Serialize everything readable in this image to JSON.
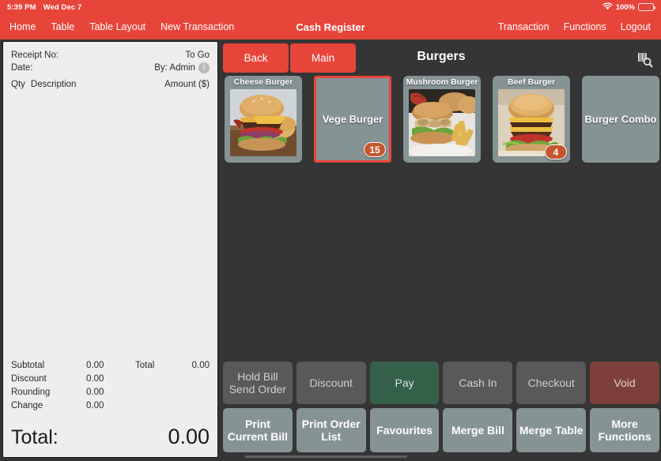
{
  "statusbar": {
    "time": "5:39 PM",
    "date": "Wed Dec 7",
    "wifi_icon": "wifi-icon",
    "battery_percent": "100%",
    "battery_icon": "battery-full-icon"
  },
  "navbar": {
    "title": "Cash Register",
    "left_items": [
      {
        "label": "Home",
        "name": "nav-home"
      },
      {
        "label": "Table",
        "name": "nav-table"
      },
      {
        "label": "Table Layout",
        "name": "nav-table-layout"
      },
      {
        "label": "New Transaction",
        "name": "nav-new-transaction"
      }
    ],
    "right_items": [
      {
        "label": "Transaction",
        "name": "nav-transaction"
      },
      {
        "label": "Functions",
        "name": "nav-functions"
      },
      {
        "label": "Logout",
        "name": "nav-logout"
      }
    ]
  },
  "receipt": {
    "receipt_no_label": "Receipt No:",
    "receipt_no_value": "",
    "order_type": "To Go",
    "date_label": "Date:",
    "date_value": "",
    "by_label": "By: Admin",
    "info_icon": "info-icon",
    "col_qty": "Qty",
    "col_description": "Description",
    "col_amount": "Amount ($)",
    "items": [],
    "totals": [
      {
        "label": "Subtotal",
        "value": "0.00"
      },
      {
        "label": "Discount",
        "value": "0.00"
      },
      {
        "label": "Rounding",
        "value": "0.00"
      },
      {
        "label": "Change",
        "value": "0.00"
      }
    ],
    "total_side_label": "Total",
    "total_side_value": "0.00",
    "grand_label": "Total:",
    "grand_value": "0.00"
  },
  "category_bar": {
    "back_label": "Back",
    "main_label": "Main",
    "title": "Burgers",
    "scan_icon": "barcode-search-icon"
  },
  "products": [
    {
      "name": "Cheese Burger",
      "badge": "",
      "has_image": true,
      "selected": false,
      "style": "photo"
    },
    {
      "name": "Vege Burger",
      "badge": "15",
      "has_image": false,
      "selected": true,
      "style": "plain"
    },
    {
      "name": "Mushroom Burger",
      "badge": "",
      "has_image": true,
      "selected": false,
      "style": "photo"
    },
    {
      "name": "Beef Burger",
      "badge": "4",
      "has_image": true,
      "selected": false,
      "style": "photo"
    },
    {
      "name": "Burger Combo",
      "badge": "",
      "has_image": false,
      "selected": false,
      "style": "plain"
    }
  ],
  "action_row_1": [
    {
      "label": "Hold Bill\nSend Order",
      "variant": "grey",
      "name": "hold-bill-send-order-button"
    },
    {
      "label": "Discount",
      "variant": "grey",
      "name": "discount-button"
    },
    {
      "label": "Pay",
      "variant": "green",
      "name": "pay-button"
    },
    {
      "label": "Cash In",
      "variant": "grey",
      "name": "cash-in-button"
    },
    {
      "label": "Checkout",
      "variant": "grey",
      "name": "checkout-button"
    },
    {
      "label": "Void",
      "variant": "red",
      "name": "void-button"
    }
  ],
  "action_row_2": [
    {
      "label": "Print\nCurrent Bill",
      "variant": "slate",
      "name": "print-current-bill-button"
    },
    {
      "label": "Print Order\nList",
      "variant": "slate",
      "name": "print-order-list-button"
    },
    {
      "label": "Favourites",
      "variant": "slate",
      "name": "favourites-button"
    },
    {
      "label": "Merge Bill",
      "variant": "slate",
      "name": "merge-bill-button"
    },
    {
      "label": "Merge Table",
      "variant": "slate",
      "name": "merge-table-button"
    },
    {
      "label": "More\nFunctions",
      "variant": "slate",
      "name": "more-functions-button"
    }
  ],
  "colors": {
    "accent_red": "#e8453a",
    "body_dark": "#353535",
    "tile_slate": "#869394",
    "button_grey": "#595959",
    "pay_green": "#34604a",
    "void_red": "#7c4038",
    "badge_orange": "#c4562e",
    "receipt_paper": "#efeeec"
  }
}
